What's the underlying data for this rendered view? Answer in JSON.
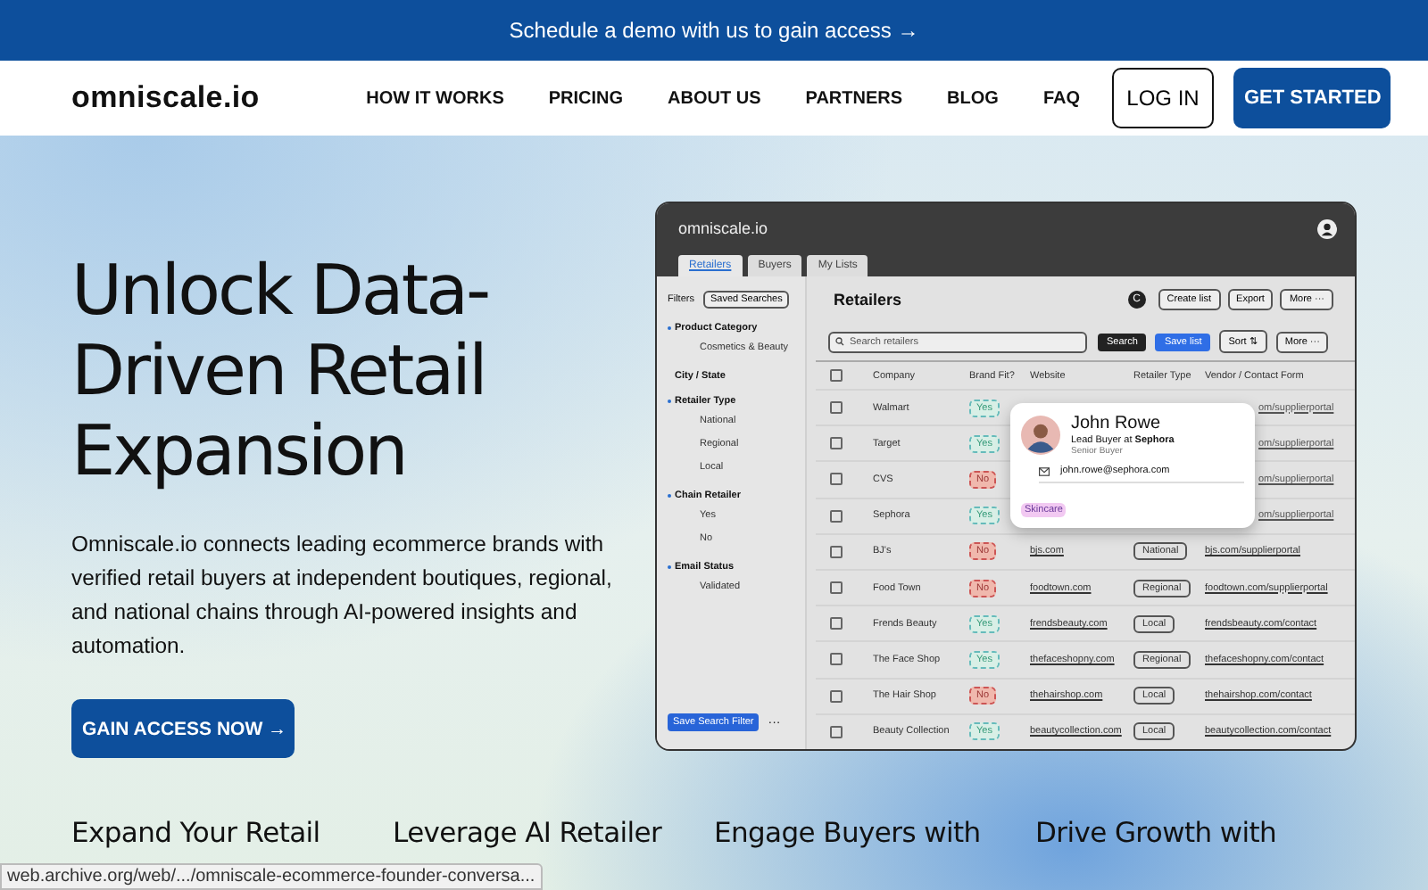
{
  "banner": {
    "text": "Schedule a demo with us to gain access →"
  },
  "nav": {
    "logo": "omniscale.io",
    "links": [
      "HOW IT WORKS",
      "PRICING",
      "ABOUT US",
      "PARTNERS",
      "BLOG",
      "FAQ"
    ],
    "login": "LOG IN",
    "cta": "GET STARTED"
  },
  "hero": {
    "title": "Unlock Data-Driven Retail Expansion",
    "text": "Omniscale.io connects leading ecommerce brands with verified retail buyers at independent boutiques, regional, and national chains through AI-powered insights and automation.",
    "button": "GAIN ACCESS NOW →"
  },
  "app": {
    "logo": "omniscale.io",
    "tabs": [
      {
        "label": "Retailers",
        "selected": true
      },
      {
        "label": "Buyers",
        "selected": false
      },
      {
        "label": "My Lists",
        "selected": false
      }
    ],
    "filters": {
      "title": "Filters",
      "saved": "Saved Searches",
      "groups": [
        {
          "label": "Product Category",
          "bullet": true,
          "children": [
            "Cosmetics & Beauty"
          ]
        },
        {
          "label": "City / State",
          "bullet": false
        },
        {
          "label": "Retailer Type",
          "bullet": true,
          "children": [
            "National",
            "Regional",
            "Local"
          ]
        },
        {
          "label": "Chain Retailer",
          "bullet": true,
          "children": [
            "Yes",
            "No"
          ]
        },
        {
          "label": "Email Status",
          "bullet": true,
          "children": [
            "Validated"
          ]
        }
      ],
      "save_button": "Save Search Filter",
      "more": "···"
    },
    "heading": "Retailers",
    "refresh": "C",
    "create": "Create list",
    "export": "Export",
    "more": "More ···",
    "search_placeholder": "Search retailers",
    "search_button": "Search",
    "save_list": "Save list",
    "sort": "Sort ⇅",
    "more2": "More ···",
    "all_checked": false,
    "columns": [
      "Company",
      "Brand Fit?",
      "Website",
      "Retailer Type",
      "Vendor / Contact Form"
    ],
    "rows": [
      {
        "company": "Walmart",
        "checked": false,
        "fit": "Yes",
        "match": true,
        "vendor": "om/supplierportal",
        "cut": true
      },
      {
        "company": "Target",
        "checked": false,
        "fit": "Yes",
        "match": true,
        "vendor": "om/supplierportal",
        "cut": true
      },
      {
        "company": "CVS",
        "checked": false,
        "fit": "No",
        "match": false,
        "vendor": "om/supplierportal",
        "cut": true
      },
      {
        "company": "Sephora",
        "checked": false,
        "fit": "Yes",
        "match": true,
        "vendor": "om/supplierportal",
        "cut": true
      },
      {
        "company": "BJ's",
        "checked": false,
        "fit": "No",
        "match": false,
        "website": "bjs.com",
        "type": "National",
        "vendor": "bjs.com/supplierportal",
        "cut": false
      },
      {
        "company": "Food Town",
        "checked": false,
        "fit": "No",
        "match": false,
        "website": "foodtown.com",
        "type": "Regional",
        "vendor": "foodtown.com/supplierportal",
        "cut": false
      },
      {
        "company": "Frends Beauty",
        "checked": false,
        "fit": "Yes",
        "match": true,
        "website": "frendsbeauty.com",
        "type": "Local",
        "vendor": "frendsbeauty.com/contact",
        "cut": false
      },
      {
        "company": "The Face Shop",
        "checked": false,
        "fit": "Yes",
        "match": true,
        "website": "thefaceshopny.com",
        "type": "Regional",
        "vendor": "thefaceshopny.com/contact",
        "cut": false
      },
      {
        "company": "The Hair Shop",
        "checked": false,
        "fit": "No",
        "match": false,
        "website": "thehairshop.com",
        "type": "Local",
        "vendor": "thehairshop.com/contact",
        "cut": false
      },
      {
        "company": "Beauty Collection",
        "checked": false,
        "fit": "Yes",
        "match": true,
        "website": "beautycollection.com",
        "type": "Local",
        "vendor": "beautycollection.com/contact",
        "cut": false
      }
    ],
    "card": {
      "name": "John Rowe",
      "role": "Lead Buyer at **Sephora**",
      "title": "Senior Buyer",
      "email": "john.rowe@sephora.com",
      "tag": "Skincare"
    }
  },
  "features": [
    "Expand Your Retail",
    "Leverage AI Retailer",
    "Engage Buyers with",
    "Drive Growth with"
  ],
  "status_bar": "web.archive.org/web/.../omniscale-ecommerce-founder-conversa..."
}
